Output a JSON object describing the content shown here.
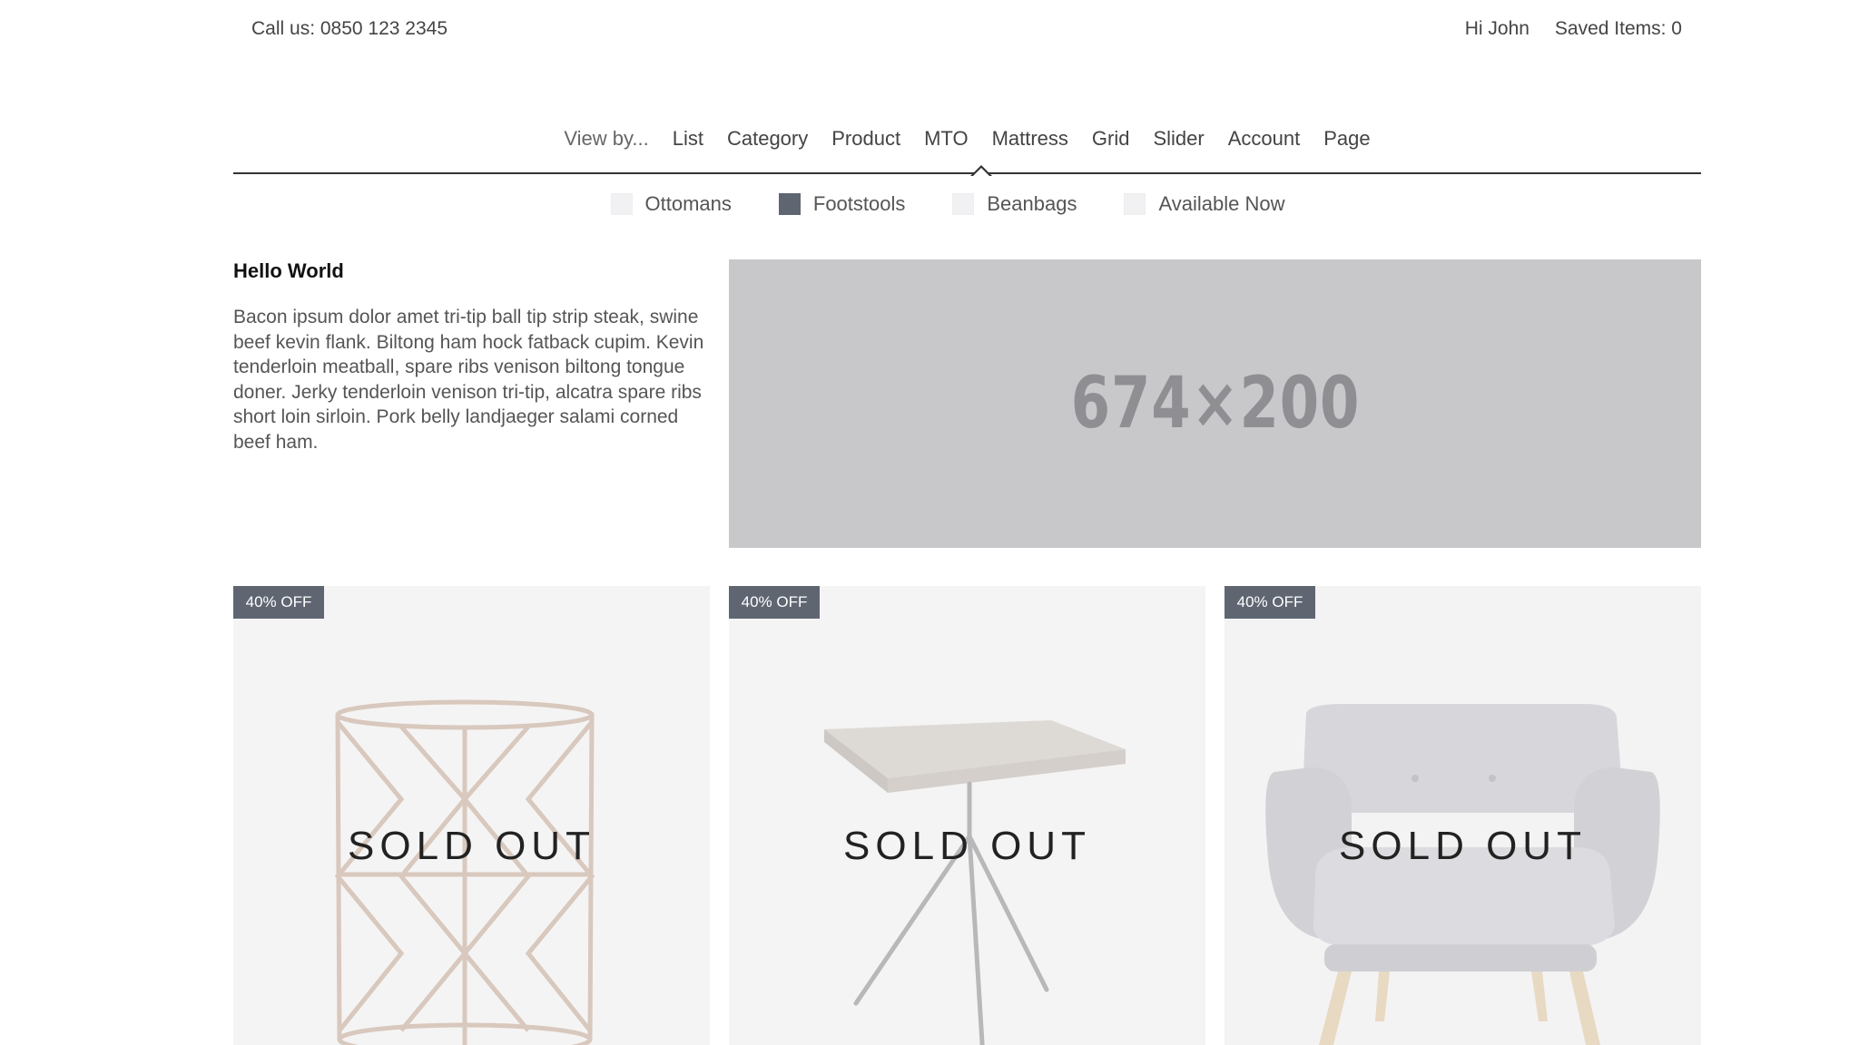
{
  "topbar": {
    "phone": "Call us: 0850 123 2345",
    "greeting": "Hi John",
    "saved_items": "Saved Items: 0"
  },
  "nav": {
    "view_by": "View by...",
    "items": [
      "List",
      "Category",
      "Product",
      "MTO",
      "Mattress",
      "Grid",
      "Slider",
      "Account",
      "Page"
    ],
    "active": "Category"
  },
  "filters": [
    {
      "label": "Ottomans",
      "checked": false
    },
    {
      "label": "Footstools",
      "checked": true
    },
    {
      "label": "Beanbags",
      "checked": false
    },
    {
      "label": "Available Now",
      "checked": false
    }
  ],
  "intro": {
    "title": "Hello World",
    "body": "Bacon ipsum dolor amet tri-tip ball tip strip steak, swine beef kevin flank. Biltong ham hock fatback cupim. Kevin tenderloin meatball, spare ribs venison biltong tongue doner. Jerky tenderloin venison tri-tip, alcatra spare ribs short loin sirloin. Pork belly landjaeger salami corned beef ham."
  },
  "hero": {
    "placeholder_text": "674×200"
  },
  "products": [
    {
      "badge": "40% OFF",
      "status": "SOLD OUT",
      "image": "wire-side-table"
    },
    {
      "badge": "40% OFF",
      "status": "SOLD OUT",
      "image": "tripod-side-table"
    },
    {
      "badge": "40% OFF",
      "status": "SOLD OUT",
      "image": "grey-armchair"
    }
  ],
  "colors": {
    "badge": "#5f6672",
    "checkbox_checked": "#5f6672",
    "placeholder_bg": "#c8c8cb",
    "nav_rule": "#333333"
  }
}
